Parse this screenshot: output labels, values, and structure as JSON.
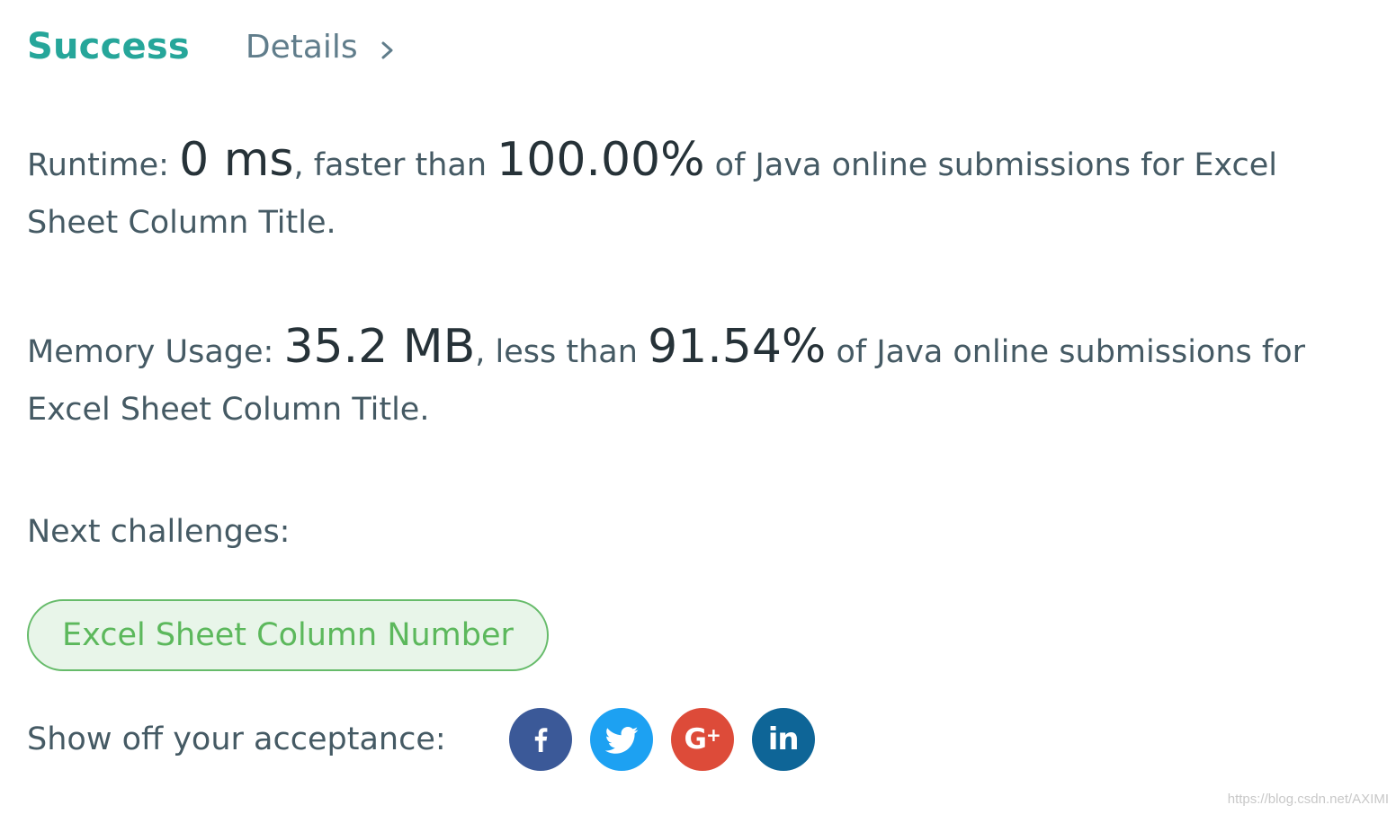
{
  "header": {
    "status": "Success",
    "details_label": "Details"
  },
  "runtime": {
    "label": "Runtime: ",
    "value": "0 ms",
    "comparison": ", faster than ",
    "percent": "100.00%",
    "suffix": " of Java online submissions for Excel Sheet Column Title."
  },
  "memory": {
    "label": "Memory Usage: ",
    "value": "35.2 MB",
    "comparison": ", less than ",
    "percent": "91.54%",
    "suffix": " of Java online submissions for Excel Sheet Column Title."
  },
  "next": {
    "label": "Next challenges:",
    "challenges": [
      "Excel Sheet Column Number"
    ]
  },
  "share": {
    "label": "Show off your acceptance:",
    "buttons": [
      {
        "icon": "facebook-icon",
        "glyph": "f",
        "color": "#3b5998"
      },
      {
        "icon": "twitter-icon",
        "glyph": "",
        "color": "#1da1f2"
      },
      {
        "icon": "google-plus-icon",
        "glyph": "G+",
        "color": "#dd4b39"
      },
      {
        "icon": "linkedin-icon",
        "glyph": "in",
        "color": "#0e6597"
      }
    ]
  },
  "watermark": "https://blog.csdn.net/AXIMI",
  "colors": {
    "accent": "#26a69a",
    "challenge_border": "#66bb6a",
    "challenge_bg": "#e8f5e9",
    "challenge_text": "#5cb85c"
  }
}
